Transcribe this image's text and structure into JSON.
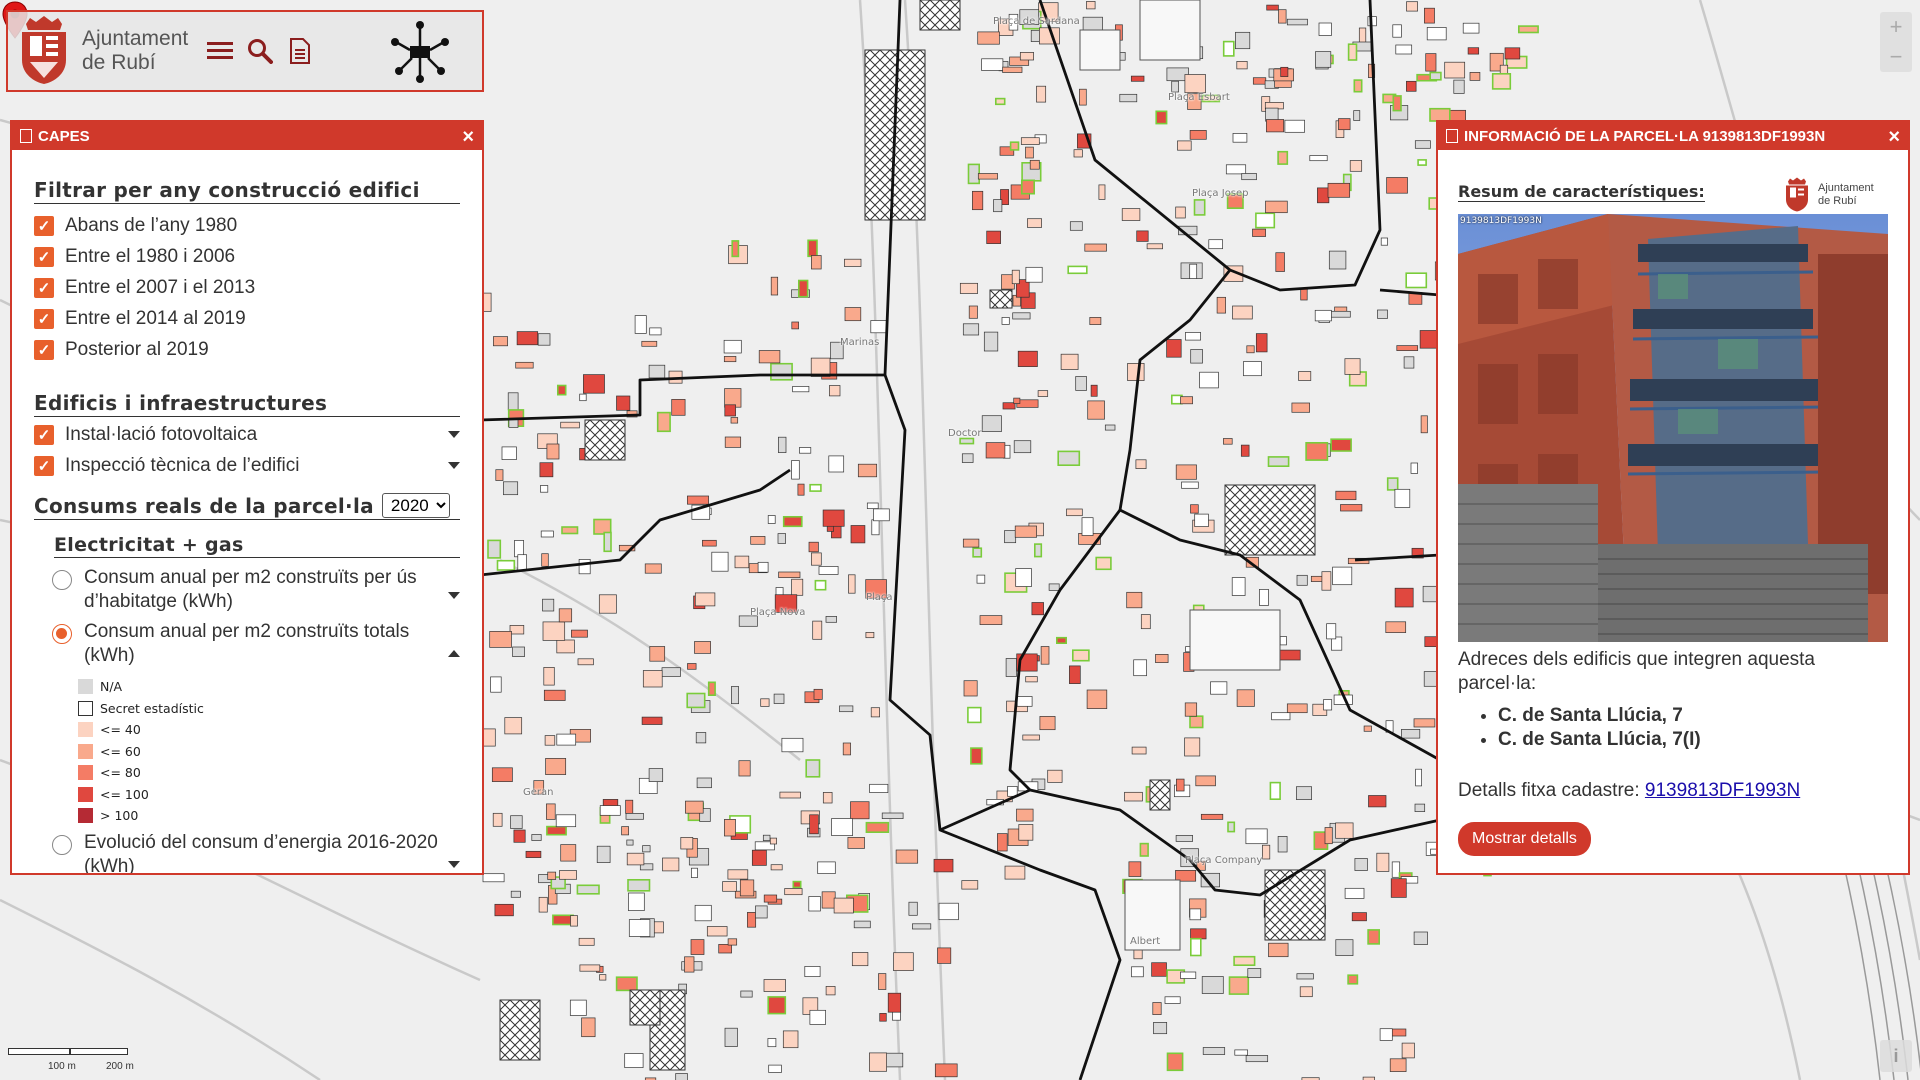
{
  "header": {
    "org_line1": "Ajuntament",
    "org_line2": "de Rubí",
    "menu_icon": "menu-icon",
    "search_icon": "search-icon",
    "doc_icon": "document-icon",
    "network_icon": "network-icon"
  },
  "layers_panel": {
    "title": "CAPES",
    "close": "×",
    "filter_title": "Filtrar per any construcció edifici",
    "filters": [
      {
        "label": "Abans de l’any 1980",
        "checked": true
      },
      {
        "label": "Entre el 1980 i 2006",
        "checked": true
      },
      {
        "label": "Entre el 2007 i el 2013",
        "checked": true
      },
      {
        "label": "Entre el 2014 al 2019",
        "checked": true
      },
      {
        "label": "Posterior al 2019",
        "checked": true
      }
    ],
    "infra_title": "Edificis i infraestructures",
    "infra": [
      {
        "label": "Instal·lació fotovoltaica",
        "checked": true
      },
      {
        "label": "Inspecció tècnica de l’edifici",
        "checked": true
      }
    ],
    "consums_title": "Consums reals de la parcel·la",
    "year": "2020",
    "elec_title": "Electricitat + gas",
    "options": [
      {
        "label": "Consum anual per m2 construïts per ús d’habitatge (kWh)",
        "selected": false
      },
      {
        "label": "Consum anual per m2 construïts totals (kWh)",
        "selected": true
      },
      {
        "label": "Evolució del consum d’energia 2016-2020 (kWh)",
        "selected": false
      }
    ],
    "legend": [
      {
        "label": "N/A",
        "color": "#d9d9d9"
      },
      {
        "label": "Secret estadístic",
        "color": "#ffffff"
      },
      {
        "label": "<= 40",
        "color": "#fcd3c1"
      },
      {
        "label": "<= 60",
        "color": "#f9a98c"
      },
      {
        "label": "<= 80",
        "color": "#f47c65"
      },
      {
        "label": "<= 100",
        "color": "#e0483f"
      },
      {
        "label": "> 100",
        "color": "#b52a34"
      }
    ]
  },
  "info_panel": {
    "title": "INFORMACIÓ DE LA PARCEL·LA 9139813DF1993N",
    "close": "×",
    "summary_title": "Resum de característiques:",
    "logo_line1": "Ajuntament",
    "logo_line2": "de Rubí",
    "photo_tag": "9139813DF1993N",
    "addresses_intro": "Adreces dels edificis que integren aquesta parcel·la:",
    "addresses": [
      "C. de Santa Llúcia, 7",
      "C. de Santa Llúcia, 7(I)"
    ],
    "cadastre_label": "Detalls fitxa cadastre:",
    "cadastre_link": "9139813DF1993N",
    "details_button": "Mostrar detalls"
  },
  "map": {
    "zoom_in": "+",
    "zoom_out": "−",
    "info": "i",
    "scale_100": "100 m",
    "scale_200": "200 m",
    "labels": [
      {
        "text": "Plaça de Sardana"
      },
      {
        "text": "Plaça Esbart"
      },
      {
        "text": "Plaça Josep"
      },
      {
        "text": "Marinas"
      },
      {
        "text": "Doctor"
      },
      {
        "text": "Plaça"
      },
      {
        "text": "Plaça Nova"
      },
      {
        "text": "Geran"
      },
      {
        "text": "Plaça Company"
      },
      {
        "text": "Albert"
      }
    ]
  }
}
